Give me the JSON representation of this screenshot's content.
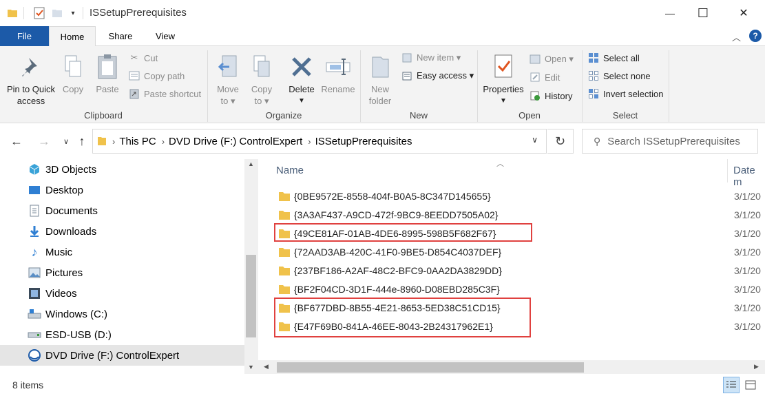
{
  "window": {
    "title": "ISSetupPrerequisites",
    "minimize_glyph": "—",
    "maximize_glyph": "☐",
    "close_glyph": "✕"
  },
  "ribbon_tabs": [
    {
      "label": "File"
    },
    {
      "label": "Home"
    },
    {
      "label": "Share"
    },
    {
      "label": "View"
    }
  ],
  "ribbon": {
    "clipboard": {
      "pin_label_1": "Pin to Quick",
      "pin_label_2": "access",
      "copy": "Copy",
      "paste": "Paste",
      "cut": "Cut",
      "copy_path": "Copy path",
      "paste_shortcut": "Paste shortcut",
      "group": "Clipboard"
    },
    "organize": {
      "move_to_1": "Move",
      "move_to_2": "to ▾",
      "copy_to_1": "Copy",
      "copy_to_2": "to ▾",
      "delete": "Delete",
      "rename": "Rename",
      "group": "Organize"
    },
    "new": {
      "new_folder_1": "New",
      "new_folder_2": "folder",
      "new_item": "New item ▾",
      "easy_access": "Easy access ▾",
      "group": "New"
    },
    "open": {
      "properties": "Properties",
      "open": "Open ▾",
      "edit": "Edit",
      "history": "History",
      "group": "Open"
    },
    "select": {
      "select_all": "Select all",
      "select_none": "Select none",
      "invert_selection": "Invert selection",
      "group": "Select"
    }
  },
  "address": {
    "crumbs": [
      "This PC",
      "DVD Drive (F:) ControlExpert",
      "ISSetupPrerequisites"
    ],
    "search_placeholder": "Search ISSetupPrerequisites"
  },
  "nav_pane": {
    "items": [
      {
        "label": "3D Objects",
        "icon": "3d-objects-icon"
      },
      {
        "label": "Desktop",
        "icon": "desktop-icon"
      },
      {
        "label": "Documents",
        "icon": "documents-icon"
      },
      {
        "label": "Downloads",
        "icon": "downloads-icon"
      },
      {
        "label": "Music",
        "icon": "music-icon"
      },
      {
        "label": "Pictures",
        "icon": "pictures-icon"
      },
      {
        "label": "Videos",
        "icon": "videos-icon"
      },
      {
        "label": "Windows (C:)",
        "icon": "drive-c-icon"
      },
      {
        "label": "ESD-USB (D:)",
        "icon": "usb-drive-icon"
      },
      {
        "label": "DVD Drive (F:) ControlExpert",
        "icon": "dvd-drive-icon",
        "selected": true
      }
    ]
  },
  "file_list": {
    "columns": [
      "Name",
      "Date m"
    ],
    "rows": [
      {
        "name": "{0BE9572E-8558-404f-B0A5-8C347D145655}",
        "date": "3/1/20"
      },
      {
        "name": "{3A3AF437-A9CD-472f-9BC9-8EEDD7505A02}",
        "date": "3/1/20"
      },
      {
        "name": "{49CE81AF-01AB-4DE6-8995-598B5F682F67}",
        "date": "3/1/20"
      },
      {
        "name": "{72AAD3AB-420C-41F0-9BE5-D854C4037DEF}",
        "date": "3/1/20"
      },
      {
        "name": "{237BF186-A2AF-48C2-BFC9-0AA2DA3829DD}",
        "date": "3/1/20"
      },
      {
        "name": "{BF2F04CD-3D1F-444e-8960-D08EBD285C3F}",
        "date": "3/1/20"
      },
      {
        "name": "{BF677DBD-8B55-4E21-8653-5ED38C51CD15}",
        "date": "3/1/20"
      },
      {
        "name": "{E47F69B0-841A-46EE-8043-2B24317962E1}",
        "date": "3/1/20"
      }
    ]
  },
  "status": {
    "item_count": "8 items"
  },
  "colors": {
    "folder": "#f0c24b",
    "highlight_box": "#e0413f",
    "file_tab": "#1c5aa8"
  }
}
